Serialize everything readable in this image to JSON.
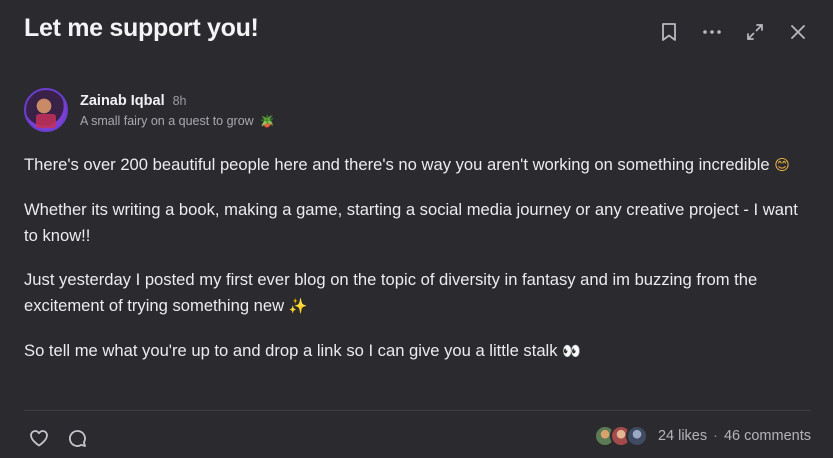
{
  "post": {
    "title": "Let me support you!",
    "author": {
      "name": "Zainab Iqbal",
      "time": "8h",
      "tagline": "A small fairy on a quest to grow",
      "tagline_icon": "🪴"
    },
    "paragraphs": [
      {
        "text": "There's over 200 beautiful people here and there's no way you aren't working on something incredible",
        "emoji": "😊"
      },
      {
        "text": "Whether its writing a book, making a game, starting a social media journey or any creative project - I want to know!!",
        "emoji": ""
      },
      {
        "text": "Just yesterday I posted my first ever blog on the topic of diversity in fantasy and im buzzing from the excitement of trying something new",
        "emoji": "✨"
      },
      {
        "text": "So tell me what you're up to and drop a link so I can give you a little stalk",
        "emoji": "👀"
      }
    ],
    "footer": {
      "likes": "24 likes",
      "separator": "·",
      "comments": "46 comments"
    }
  },
  "icons": {
    "bookmark": "bookmark-icon",
    "more": "more-icon",
    "expand": "expand-icon",
    "close": "close-icon",
    "like": "heart-icon",
    "comment": "comment-icon"
  }
}
